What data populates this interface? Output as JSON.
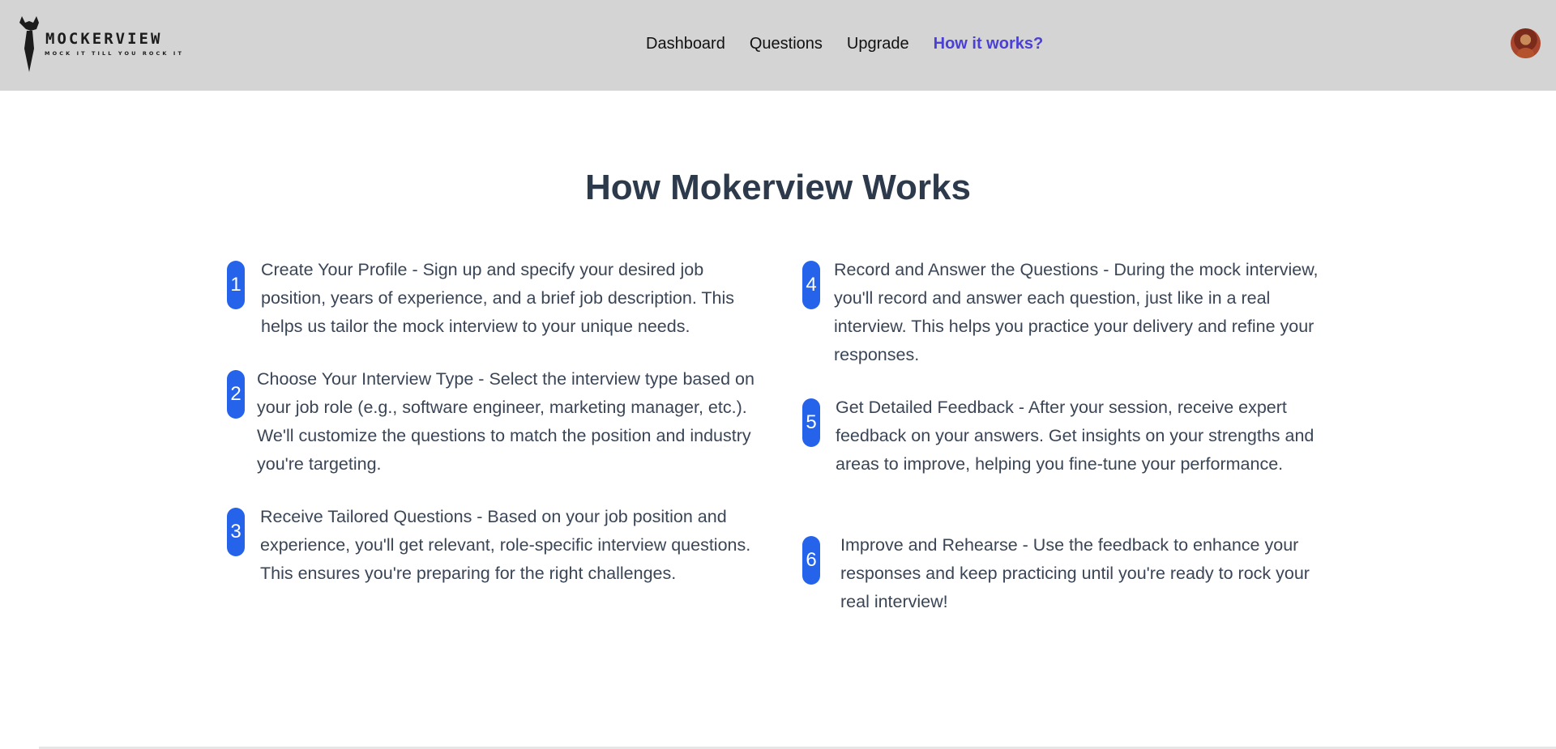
{
  "header": {
    "logo": {
      "name": "MOCKERVIEW",
      "tagline": "MOCK IT TILL YOU ROCK IT"
    },
    "nav": [
      {
        "label": "Dashboard",
        "active": false
      },
      {
        "label": "Questions",
        "active": false
      },
      {
        "label": "Upgrade",
        "active": false
      },
      {
        "label": "How it works?",
        "active": true
      }
    ],
    "accent_color": "#4a3fd6",
    "background_color": "#d4d4d4"
  },
  "main": {
    "title": "How Mokerview Works",
    "badge_color": "#2563eb",
    "steps": [
      {
        "number": "1",
        "text": "Create Your Profile - Sign up and specify your desired job position, years of experience, and a brief job description. This helps us tailor the mock interview to your unique needs."
      },
      {
        "number": "2",
        "text": "Choose Your Interview Type - Select the interview type based on your job role (e.g., software engineer, marketing manager, etc.). We'll customize the questions to match the position and industry you're targeting."
      },
      {
        "number": "3",
        "text": "Receive Tailored Questions - Based on your job position and experience, you'll get relevant, role-specific interview questions. This ensures you're preparing for the right challenges."
      },
      {
        "number": "4",
        "text": "Record and Answer the Questions - During the mock interview, you'll record and answer each question, just like in a real interview. This helps you practice your delivery and refine your responses."
      },
      {
        "number": "5",
        "text": "Get Detailed Feedback - After your session, receive expert feedback on your answers. Get insights on your strengths and areas to improve, helping you fine-tune your performance."
      },
      {
        "number": "6",
        "text": "Improve and Rehearse - Use the feedback to enhance your responses and keep practicing until you're ready to rock your real interview!"
      }
    ]
  }
}
